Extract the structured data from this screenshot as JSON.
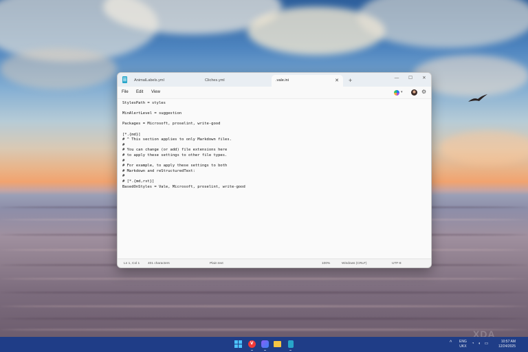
{
  "window": {
    "tabs": [
      {
        "label": "AnimalLabels.yml",
        "active": false
      },
      {
        "label": "Cliches.yml",
        "active": false
      },
      {
        "label": ".vale.ini",
        "active": true
      }
    ],
    "new_tab": "+",
    "tab_close": "✕",
    "controls": {
      "minimize": "—",
      "maximize": "☐",
      "close": "✕"
    },
    "menu": {
      "file": "File",
      "edit": "Edit",
      "view": "View"
    },
    "icons": {
      "copilot": "copilot-icon",
      "avatar": "avatar-icon",
      "settings": "gear-icon"
    }
  },
  "editor": {
    "lines": [
      "StylesPath = styles",
      "",
      "MinAlertLevel = suggestion",
      "",
      "Packages = Microsoft, proselint, write-good",
      "",
      "[*.{md}]",
      "# ^ This section applies to only Markdown files.",
      "#",
      "# You can change (or add) file extensions here",
      "# to apply these settings to other file types.",
      "#",
      "# For example, to apply these settings to both",
      "# Markdown and reStructuredText:",
      "#",
      "# [*.{md,rst}]",
      "BasedOnStyles = Vale, Microsoft, proselint, write-good"
    ]
  },
  "status": {
    "position": "Ln 1, Col 1",
    "characters": "401 characters",
    "format": "Plain text",
    "zoom": "100%",
    "line_ending": "Windows (CRLF)",
    "encoding": "UTF-8"
  },
  "taskbar": {
    "apps": [
      "start-icon",
      "vivaldi-icon",
      "feather-icon",
      "file-explorer-icon",
      "notepad-icon"
    ],
    "tray_chevron": "^",
    "language_line1": "ENG",
    "language_line2": "UKX",
    "system_icons": "◔ ◖ ▭",
    "clock_time": "10:57 AM",
    "clock_date": "12/24/2025"
  },
  "watermark": "XDA"
}
